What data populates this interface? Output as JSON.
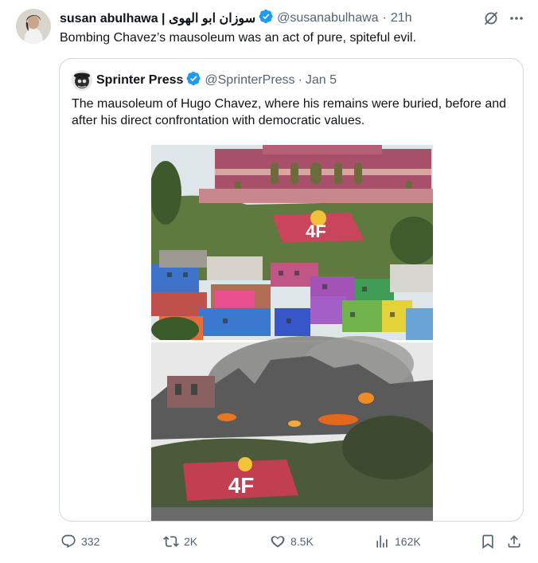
{
  "tweet": {
    "author_name": "susan abulhawa | سوزان ابو الهوى",
    "author_handle": "@susanabulhawa",
    "separator": "·",
    "time": "21h",
    "text": "Bombing Chavez’s mausoleum was an act of pure, spiteful evil."
  },
  "quote": {
    "author_name": "Sprinter Press",
    "author_handle": "@SprinterPress",
    "separator": "·",
    "time": "Jan 5",
    "text": "The mausoleum of Hugo Chavez, where his remains were buried, before and after his direct confrontation with democratic values.",
    "image_sign_top": "4F",
    "image_sign_bottom": "4F"
  },
  "actions": {
    "replies": "332",
    "reposts": "2K",
    "likes": "8.5K",
    "views": "162K"
  },
  "colors": {
    "verified": "#1d9bf0",
    "secondary_text": "#536471",
    "border": "#cfd9de"
  },
  "icons": [
    "verified-badge-icon",
    "grok-icon",
    "more-icon",
    "reply-icon",
    "repost-icon",
    "like-icon",
    "views-icon",
    "bookmark-icon",
    "share-icon"
  ]
}
